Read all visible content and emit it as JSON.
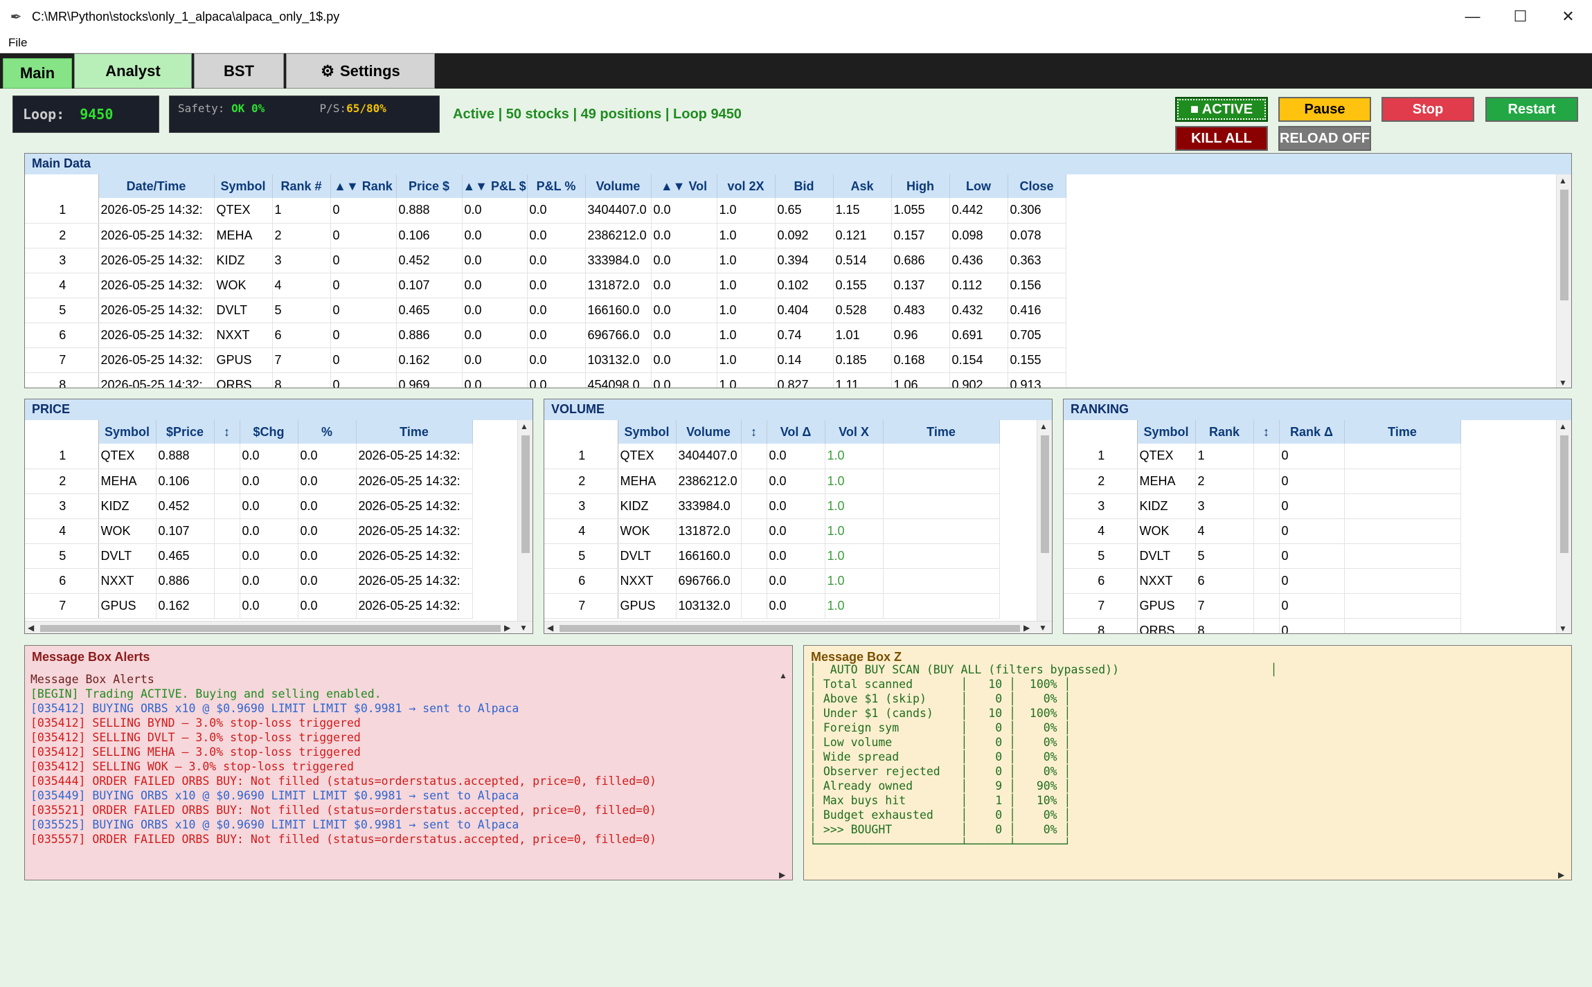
{
  "window": {
    "title": "C:\\MR\\Python\\stocks\\only_1_alpaca\\alpaca_only_1$.py",
    "minimize": "—",
    "maximize": "☐",
    "close": "✕"
  },
  "menu": {
    "file": "File"
  },
  "tabs": {
    "main": "Main",
    "analyst": "Analyst",
    "bst": "BST",
    "settings": "Settings"
  },
  "status": {
    "loop_label": "Loop:",
    "loop_value": "9450",
    "safety_label": "Safety:",
    "safety_value": "OK 0%",
    "ps_label": "P/S:",
    "ps_value": "65/80%",
    "summary": "Active | 50 stocks | 49 positions | Loop 9450"
  },
  "controls": {
    "active": "■ ACTIVE",
    "pause": "Pause",
    "stop": "Stop",
    "restart": "Restart",
    "kill_all": "KILL ALL",
    "reload": "RELOAD OFF"
  },
  "main_data": {
    "title": "Main Data",
    "columns": [
      "Date/Time",
      "Symbol",
      "Rank #",
      "▲▼ Rank",
      "Price $",
      "▲▼ P&L $",
      "P&L %",
      "Volume",
      "▲▼ Vol",
      "vol 2X",
      "Bid",
      "Ask",
      "High",
      "Low",
      "Close"
    ],
    "rows": [
      [
        "1",
        "2026-05-25 14:32:",
        "QTEX",
        "1",
        "0",
        "0.888",
        "0.0",
        "0.0",
        "3404407.0",
        "0.0",
        "1.0",
        "0.65",
        "1.15",
        "1.055",
        "0.442",
        "0.306"
      ],
      [
        "2",
        "2026-05-25 14:32:",
        "MEHA",
        "2",
        "0",
        "0.106",
        "0.0",
        "0.0",
        "2386212.0",
        "0.0",
        "1.0",
        "0.092",
        "0.121",
        "0.157",
        "0.098",
        "0.078"
      ],
      [
        "3",
        "2026-05-25 14:32:",
        "KIDZ",
        "3",
        "0",
        "0.452",
        "0.0",
        "0.0",
        "333984.0",
        "0.0",
        "1.0",
        "0.394",
        "0.514",
        "0.686",
        "0.436",
        "0.363"
      ],
      [
        "4",
        "2026-05-25 14:32:",
        "WOK",
        "4",
        "0",
        "0.107",
        "0.0",
        "0.0",
        "131872.0",
        "0.0",
        "1.0",
        "0.102",
        "0.155",
        "0.137",
        "0.112",
        "0.156"
      ],
      [
        "5",
        "2026-05-25 14:32:",
        "DVLT",
        "5",
        "0",
        "0.465",
        "0.0",
        "0.0",
        "166160.0",
        "0.0",
        "1.0",
        "0.404",
        "0.528",
        "0.483",
        "0.432",
        "0.416"
      ],
      [
        "6",
        "2026-05-25 14:32:",
        "NXXT",
        "6",
        "0",
        "0.886",
        "0.0",
        "0.0",
        "696766.0",
        "0.0",
        "1.0",
        "0.74",
        "1.01",
        "0.96",
        "0.691",
        "0.705"
      ],
      [
        "7",
        "2026-05-25 14:32:",
        "GPUS",
        "7",
        "0",
        "0.162",
        "0.0",
        "0.0",
        "103132.0",
        "0.0",
        "1.0",
        "0.14",
        "0.185",
        "0.168",
        "0.154",
        "0.155"
      ],
      [
        "8",
        "2026-05-25 14:32:",
        "ORBS",
        "8",
        "0",
        "0.969",
        "0.0",
        "0.0",
        "454098.0",
        "0.0",
        "1.0",
        "0.827",
        "1.11",
        "1.06",
        "0.902",
        "0.913"
      ]
    ]
  },
  "price": {
    "title": "PRICE",
    "columns": [
      "Symbol",
      "$Price",
      "↕",
      "$Chg",
      "%",
      "Time"
    ],
    "rows": [
      [
        "1",
        "QTEX",
        "0.888",
        "",
        "0.0",
        "0.0",
        "2026-05-25 14:32:"
      ],
      [
        "2",
        "MEHA",
        "0.106",
        "",
        "0.0",
        "0.0",
        "2026-05-25 14:32:"
      ],
      [
        "3",
        "KIDZ",
        "0.452",
        "",
        "0.0",
        "0.0",
        "2026-05-25 14:32:"
      ],
      [
        "4",
        "WOK",
        "0.107",
        "",
        "0.0",
        "0.0",
        "2026-05-25 14:32:"
      ],
      [
        "5",
        "DVLT",
        "0.465",
        "",
        "0.0",
        "0.0",
        "2026-05-25 14:32:"
      ],
      [
        "6",
        "NXXT",
        "0.886",
        "",
        "0.0",
        "0.0",
        "2026-05-25 14:32:"
      ],
      [
        "7",
        "GPUS",
        "0.162",
        "",
        "0.0",
        "0.0",
        "2026-05-25 14:32:"
      ]
    ]
  },
  "volume": {
    "title": "VOLUME",
    "columns": [
      "Symbol",
      "Volume",
      "↕",
      "Vol Δ",
      "Vol X",
      "Time"
    ],
    "rows": [
      [
        "1",
        "QTEX",
        "3404407.0",
        "",
        "0.0",
        "1.0",
        ""
      ],
      [
        "2",
        "MEHA",
        "2386212.0",
        "",
        "0.0",
        "1.0",
        ""
      ],
      [
        "3",
        "KIDZ",
        "333984.0",
        "",
        "0.0",
        "1.0",
        ""
      ],
      [
        "4",
        "WOK",
        "131872.0",
        "",
        "0.0",
        "1.0",
        ""
      ],
      [
        "5",
        "DVLT",
        "166160.0",
        "",
        "0.0",
        "1.0",
        ""
      ],
      [
        "6",
        "NXXT",
        "696766.0",
        "",
        "0.0",
        "1.0",
        ""
      ],
      [
        "7",
        "GPUS",
        "103132.0",
        "",
        "0.0",
        "1.0",
        ""
      ]
    ]
  },
  "ranking": {
    "title": "RANKING",
    "columns": [
      "Symbol",
      "Rank",
      "↕",
      "Rank Δ",
      "Time"
    ],
    "rows": [
      [
        "1",
        "QTEX",
        "1",
        "",
        "0",
        ""
      ],
      [
        "2",
        "MEHA",
        "2",
        "",
        "0",
        ""
      ],
      [
        "3",
        "KIDZ",
        "3",
        "",
        "0",
        ""
      ],
      [
        "4",
        "WOK",
        "4",
        "",
        "0",
        ""
      ],
      [
        "5",
        "DVLT",
        "5",
        "",
        "0",
        ""
      ],
      [
        "6",
        "NXXT",
        "6",
        "",
        "0",
        ""
      ],
      [
        "7",
        "GPUS",
        "7",
        "",
        "0",
        ""
      ],
      [
        "8",
        "ORBS",
        "8",
        "",
        "0",
        ""
      ]
    ]
  },
  "alerts": {
    "title": "Message Box Alerts",
    "lines": [
      {
        "text": "Message Box Alerts",
        "cls": "c-title"
      },
      {
        "text": "[BEGIN] Trading ACTIVE. Buying and selling enabled.",
        "cls": "c-green"
      },
      {
        "text": "[035412] BUYING ORBS x10 @ $0.9690 LIMIT LIMIT $0.9981 → sent to Alpaca",
        "cls": "c-blue"
      },
      {
        "text": "[035412] SELLING BYND — 3.0% stop-loss triggered",
        "cls": "c-red"
      },
      {
        "text": "[035412] SELLING DVLT — 3.0% stop-loss triggered",
        "cls": "c-red"
      },
      {
        "text": "[035412] SELLING MEHA — 3.0% stop-loss triggered",
        "cls": "c-red"
      },
      {
        "text": "[035412] SELLING WOK — 3.0% stop-loss triggered",
        "cls": "c-red"
      },
      {
        "text": "[035444] ORDER FAILED ORBS BUY: Not filled (status=orderstatus.accepted, price=0, filled=0)",
        "cls": "c-red"
      },
      {
        "text": "[035449] BUYING ORBS x10 @ $0.9690 LIMIT LIMIT $0.9981 → sent to Alpaca",
        "cls": "c-blue"
      },
      {
        "text": "[035521] ORDER FAILED ORBS BUY: Not filled (status=orderstatus.accepted, price=0, filled=0)",
        "cls": "c-red"
      },
      {
        "text": "[035525] BUYING ORBS x10 @ $0.9690 LIMIT LIMIT $0.9981 → sent to Alpaca",
        "cls": "c-blue"
      },
      {
        "text": "[035557] ORDER FAILED ORBS BUY: Not filled (status=orderstatus.accepted, price=0, filled=0)",
        "cls": "c-red"
      }
    ]
  },
  "msgz": {
    "title": "Message Box Z",
    "lines": [
      "│  AUTO BUY SCAN (BUY ALL (filters bypassed))                      │",
      "│ Total scanned       │   10 │  100% │",
      "│ Above $1 (skip)     │    0 │    0% │",
      "│ Under $1 (cands)    │   10 │  100% │",
      "│ Foreign sym         │    0 │    0% │",
      "│ Low volume          │    0 │    0% │",
      "│ Wide spread         │    0 │    0% │",
      "│ Observer rejected   │    0 │    0% │",
      "│ Already owned       │    9 │   90% │",
      "│ Max buys hit        │    1 │   10% │",
      "│ Budget exhausted    │    0 │    0% │",
      "│ >>> BOUGHT          │    0 │    0% │",
      "└─────────────────────┴──────┴───────┘"
    ]
  }
}
